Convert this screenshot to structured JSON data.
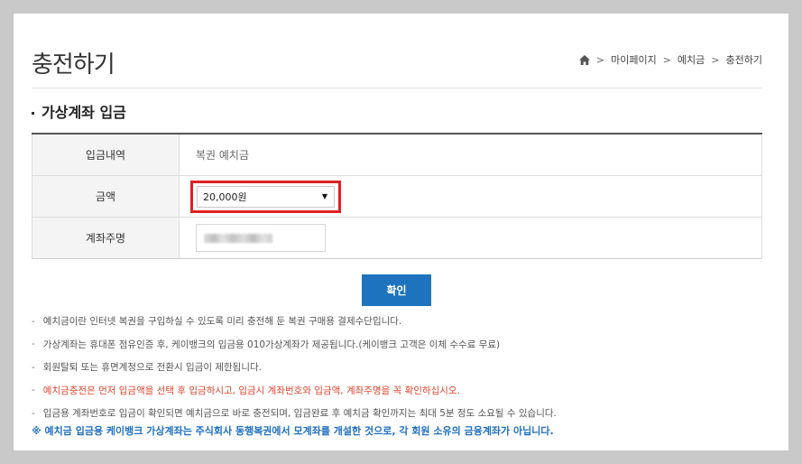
{
  "page": {
    "title": "충전하기"
  },
  "breadcrumb": {
    "home_icon": "home-icon",
    "items": [
      "마이페이지",
      "예치금",
      "충전하기"
    ],
    "separator": ">"
  },
  "section": {
    "title": "가상계좌 입금"
  },
  "form": {
    "rows": [
      {
        "label": "입금내역",
        "value": "복권 예치금"
      },
      {
        "label": "금액",
        "value": "20,000원"
      },
      {
        "label": "계좌주명",
        "value": ""
      }
    ],
    "amount_arrow": "▼"
  },
  "confirm_button": {
    "label": "확인"
  },
  "notes": [
    {
      "dash": "-",
      "text": "예치금이란 인터넷 복권을 구입하실 수 있도록 미리 충전해 둔 복권 구매용 결제수단입니다."
    },
    {
      "dash": "-",
      "text": "가상계좌는 휴대폰 점유인증 후, 케이뱅크의 입금용 010가상계좌가 제공됩니다.(케이뱅크 고객은 이체 수수료 무료)"
    },
    {
      "dash": "-",
      "text": "회원탈퇴 또는 휴면계정으로 전환시 입금이 제한됩니다."
    },
    {
      "dash": "-",
      "text": "예치금충전은 먼저 입금액을 선택 후 입금하시고, 입금시 계좌번호와 입금액, 계좌주명을 꼭 확인하십시오."
    },
    {
      "dash": "-",
      "text": "입금용 계좌번호로 입금이 확인되면 예치금으로 바로 충전되며, 입금완료 후 예치금 확인까지는 최대 5분 정도 소요될 수 있습니다."
    }
  ],
  "footer_note": "※ 예치금 입금용 케이뱅크 가상계좌는 주식회사 동행복권에서 모계좌를 개설한 것으로, 각 회원 소유의 금융계좌가 아닙니다.",
  "colors": {
    "primary_button": "#1e73be",
    "highlight_border": "#e02020",
    "warning_text": "#e0452c",
    "footer_text": "#1e6fc1"
  }
}
